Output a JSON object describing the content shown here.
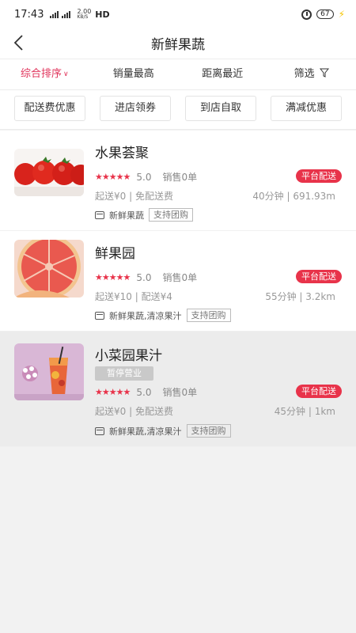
{
  "status_bar": {
    "time": "17:43",
    "net_speed": "2.00",
    "net_unit": "KB/S",
    "hd": "HD",
    "battery": "67"
  },
  "header": {
    "title": "新鲜果蔬"
  },
  "sort_tabs": [
    {
      "label": "综合排序",
      "active": true
    },
    {
      "label": "销量最高",
      "active": false
    },
    {
      "label": "距离最近",
      "active": false
    },
    {
      "label": "筛选",
      "active": false
    }
  ],
  "filter_chips": [
    "配送费优惠",
    "进店领券",
    "到店自取",
    "满减优惠"
  ],
  "shops": [
    {
      "name": "水果荟聚",
      "rating": "5.0",
      "sales": "销售0单",
      "badge": "平台配送",
      "fees": "起送¥0 | 免配送费",
      "eta": "40分钟 | 691.93m",
      "category": "新鲜果蔬",
      "tag": "支持团购",
      "paused": "",
      "image": "tomatoes"
    },
    {
      "name": "鲜果园",
      "rating": "5.0",
      "sales": "销售0单",
      "badge": "平台配送",
      "fees": "起送¥10 | 配送¥4",
      "eta": "55分钟 | 3.2km",
      "category": "新鲜果蔬,清凉果汁",
      "tag": "支持团购",
      "paused": "",
      "image": "grapefruit"
    },
    {
      "name": "小菜园果汁",
      "rating": "5.0",
      "sales": "销售0单",
      "badge": "平台配送",
      "fees": "起送¥0 | 免配送费",
      "eta": "45分钟 | 1km",
      "category": "新鲜果蔬,清凉果汁",
      "tag": "支持团购",
      "paused": "暂停营业",
      "image": "juice"
    }
  ],
  "colors": {
    "accent": "#e0325a",
    "badge": "#e8334a",
    "star": "#e8334a"
  }
}
